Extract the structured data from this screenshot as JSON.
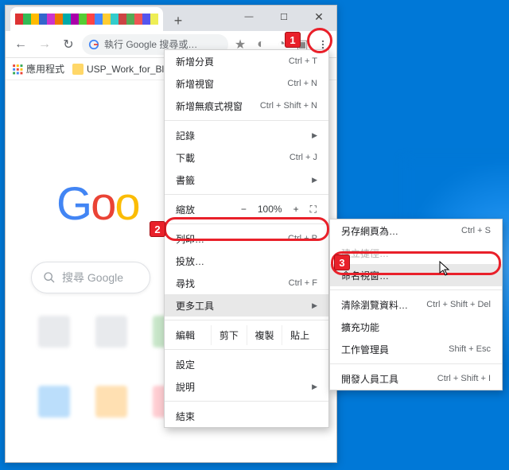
{
  "window": {
    "min": "—",
    "max": "☐",
    "close": "✕"
  },
  "toolbar": {
    "omnibox_text": "執行 Google 搜尋或…",
    "back": "←",
    "fwd": "→",
    "reload": "↻"
  },
  "bookmarks": {
    "apps_label": "應用程式",
    "folder1_label": "USP_Work_for_Bl…"
  },
  "page": {
    "logo_letters": [
      "G",
      "o",
      "o"
    ],
    "search_placeholder": "搜尋 Google"
  },
  "menu": {
    "new_tab": {
      "label": "新增分頁",
      "shortcut": "Ctrl + T"
    },
    "new_window": {
      "label": "新增視窗",
      "shortcut": "Ctrl + N"
    },
    "incognito": {
      "label": "新增無痕式視窗",
      "shortcut": "Ctrl + Shift + N"
    },
    "history": {
      "label": "記錄"
    },
    "downloads": {
      "label": "下載",
      "shortcut": "Ctrl + J"
    },
    "bookmarks": {
      "label": "書籤"
    },
    "zoom": {
      "label": "縮放",
      "minus": "−",
      "value": "100%",
      "plus": "+",
      "fs": "⛶"
    },
    "print": {
      "label": "列印…",
      "shortcut": "Ctrl + P"
    },
    "cast": {
      "label": "投放…"
    },
    "find": {
      "label": "尋找",
      "shortcut": "Ctrl + F"
    },
    "more_tools": {
      "label": "更多工具"
    },
    "edit": {
      "label": "編輯",
      "cut": "剪下",
      "copy": "複製",
      "paste": "貼上"
    },
    "settings": {
      "label": "設定"
    },
    "help": {
      "label": "說明"
    },
    "exit": {
      "label": "結束"
    }
  },
  "submenu": {
    "save_page": {
      "label": "另存網頁為…",
      "shortcut": "Ctrl + S"
    },
    "create_shortcut": {
      "label": "建立捷徑…"
    },
    "name_window": {
      "label": "命名視窗…"
    },
    "clear_data": {
      "label": "清除瀏覽資料…",
      "shortcut": "Ctrl + Shift + Del"
    },
    "extensions": {
      "label": "擴充功能"
    },
    "task_manager": {
      "label": "工作管理員",
      "shortcut": "Shift + Esc"
    },
    "dev_tools": {
      "label": "開發人員工具",
      "shortcut": "Ctrl + Shift + I"
    }
  },
  "callouts": {
    "c1": "1",
    "c2": "2",
    "c3": "3"
  }
}
